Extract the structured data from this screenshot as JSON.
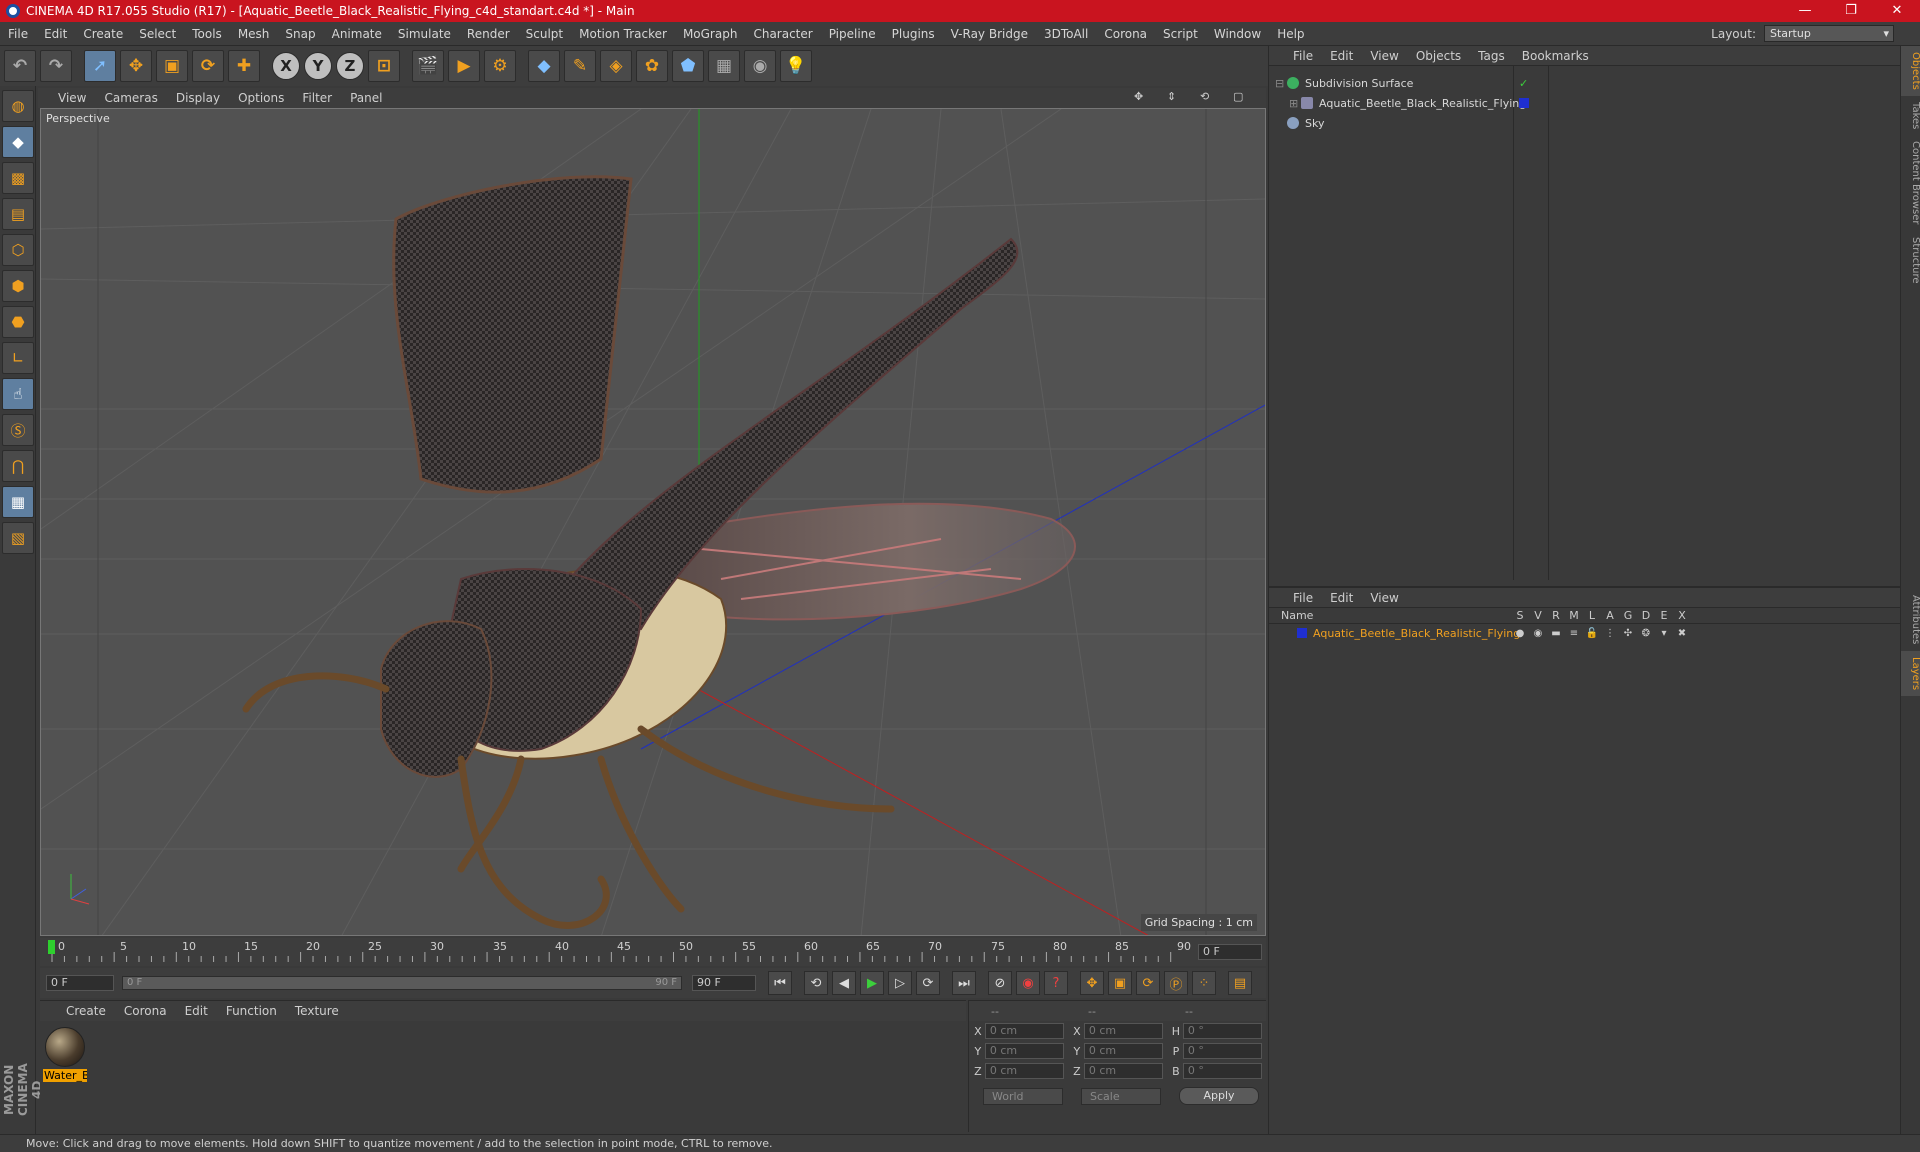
{
  "window": {
    "title": "CINEMA 4D R17.055 Studio (R17) - [Aquatic_Beetle_Black_Realistic_Flying_c4d_standart.c4d *] - Main"
  },
  "menus": [
    "File",
    "Edit",
    "Create",
    "Select",
    "Tools",
    "Mesh",
    "Snap",
    "Animate",
    "Simulate",
    "Render",
    "Sculpt",
    "Motion Tracker",
    "MoGraph",
    "Character",
    "Pipeline",
    "Plugins",
    "V-Ray Bridge",
    "3DToAll",
    "Corona",
    "Script",
    "Window",
    "Help"
  ],
  "layout": {
    "label": "Layout:",
    "value": "Startup"
  },
  "viewport": {
    "menus": [
      "View",
      "Cameras",
      "Display",
      "Options",
      "Filter",
      "Panel"
    ],
    "label": "Perspective",
    "grid_spacing": "Grid Spacing : 1 cm"
  },
  "timeline": {
    "ticks": [
      "0",
      "5",
      "10",
      "15",
      "20",
      "25",
      "30",
      "35",
      "40",
      "45",
      "50",
      "55",
      "60",
      "65",
      "70",
      "75",
      "80",
      "85",
      "90"
    ],
    "current_frame": "0 F",
    "start_field": "0 F",
    "slider_left": "0 F",
    "slider_right": "90 F",
    "end_field": "90 F"
  },
  "materials": {
    "menus": [
      "Create",
      "Corona",
      "Edit",
      "Function",
      "Texture"
    ],
    "items": [
      {
        "name": "Water_B"
      }
    ]
  },
  "coordinates": {
    "headers": [
      "--",
      "--",
      "--"
    ],
    "rows": [
      {
        "a1": "X",
        "v1": "0 cm",
        "a2": "X",
        "v2": "0 cm",
        "a3": "H",
        "v3": "0 °"
      },
      {
        "a1": "Y",
        "v1": "0 cm",
        "a2": "Y",
        "v2": "0 cm",
        "a3": "P",
        "v3": "0 °"
      },
      {
        "a1": "Z",
        "v1": "0 cm",
        "a2": "Z",
        "v2": "0 cm",
        "a3": "B",
        "v3": "0 °"
      }
    ],
    "mode": "World",
    "type": "Scale",
    "apply": "Apply"
  },
  "objects": {
    "menus": [
      "File",
      "Edit",
      "View",
      "Objects",
      "Tags",
      "Bookmarks"
    ],
    "items": [
      {
        "name": "Subdivision Surface"
      },
      {
        "name": "Aquatic_Beetle_Black_Realistic_Flying"
      },
      {
        "name": "Sky"
      }
    ]
  },
  "layers": {
    "menus": [
      "File",
      "Edit",
      "View"
    ],
    "name_header": "Name",
    "columns": [
      "S",
      "V",
      "R",
      "M",
      "L",
      "A",
      "G",
      "D",
      "E",
      "X"
    ],
    "items": [
      {
        "name": "Aquatic_Beetle_Black_Realistic_Flying"
      }
    ]
  },
  "side_tabs": [
    "Objects",
    "Takes",
    "Content Browser",
    "Structure",
    "Attributes",
    "Layers"
  ],
  "status": "Move: Click and drag to move elements. Hold down SHIFT to quantize movement / add to the selection in point mode, CTRL to remove.",
  "brand": "MAXON CINEMA 4D",
  "colors": {
    "title_bar": "#c9141f",
    "accent": "#f0a020",
    "layer_color": "#1f2fd0"
  }
}
